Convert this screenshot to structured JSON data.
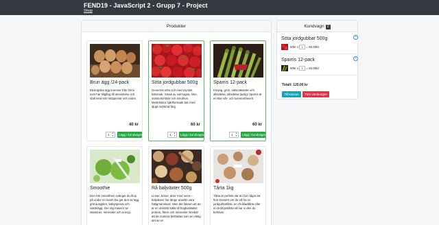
{
  "header": {
    "title": "FEND19 - JavaScript 2 - Grupp 7 - Project",
    "nav_link": "Shop"
  },
  "products": {
    "heading": "Produkter",
    "items": [
      {
        "name": "Brun ägg /24-pack",
        "description": "Ekologiska ägg kommer från höns som har tillgång till utevistelse och stall med strö strippinnar och reden",
        "price": "40 kr",
        "qty": "1",
        "add_label": "Lägg i kundvagnen",
        "image": "eggs-image"
      },
      {
        "name": "Söta jordgubbar 500g",
        "description": "Generöst söta och med mycket bärsmak. Smak av solmogna, lime, svarta körsbär och smultron. Medelstora hjärtformade bär med djupt mörkröd färg",
        "price": "60 kr",
        "qty": "1",
        "add_label": "Lägg i kundvagnen",
        "image": "strawberries-image"
      },
      {
        "name": "Sparris 12-pack",
        "description": "Krispig, grön, välsmakande och allsidelas, allsidelas ljuvlig! Sparris är en klar vår- och sommarfavorit",
        "price": "60 kr",
        "qty": "1",
        "add_label": "Lägg i kundvagnen",
        "image": "asparagus-image"
      },
      {
        "name": "Smoothie",
        "description": "Den här smoothien svänger du ihop på under en kvart! Du gör den av ägg, gröna äpplen, babyspenat och vaktelägg. Ger dig massor av vitaminer, mineraler och energi.",
        "image": "smoothie-image"
      },
      {
        "name": "Rå baljväxter 500g",
        "description": "Linser, bönor, ärtor med mera – baljväxter har länge ansetts vara fattigmanskost. Men det faktum att de är en utmärkt källa till högkvalitativt protein, fibrer och mineraler innebär att de numera betraktas som en viktig del av en",
        "image": "legumes-image"
      },
      {
        "name": "Tårta 1kg",
        "description": "Tårta är perfekt när du har något att fira! Dessert om du vill ha en jordgubbstårta, en chokladtårta eller en bröllopstårta så har vi den du behöver.",
        "image": "cake-image"
      }
    ]
  },
  "cart": {
    "heading": "Kundvagn",
    "count": "2",
    "items": [
      {
        "name": "Söta jordgubbar 500g",
        "unit": "60kr x",
        "qty": "1",
        "sum": "= 60.00kr",
        "image": "strawberries-thumb"
      },
      {
        "name": "Sparris 12-pack",
        "unit": "60kr x",
        "qty": "1",
        "sum": "= 60.00kr",
        "image": "asparagus-thumb"
      }
    ],
    "total": "Totalt: 120.00 kr",
    "checkout_label": "Till kassan",
    "empty_label": "Töm varukorgen"
  },
  "icons": {
    "remove": "close-circle-icon"
  },
  "colors": {
    "navbar": "#343a40",
    "add_button": "#28a745",
    "in_cart_border": "#5cb85c",
    "checkout_button": "#17a2b8",
    "empty_button": "#dc3545"
  }
}
